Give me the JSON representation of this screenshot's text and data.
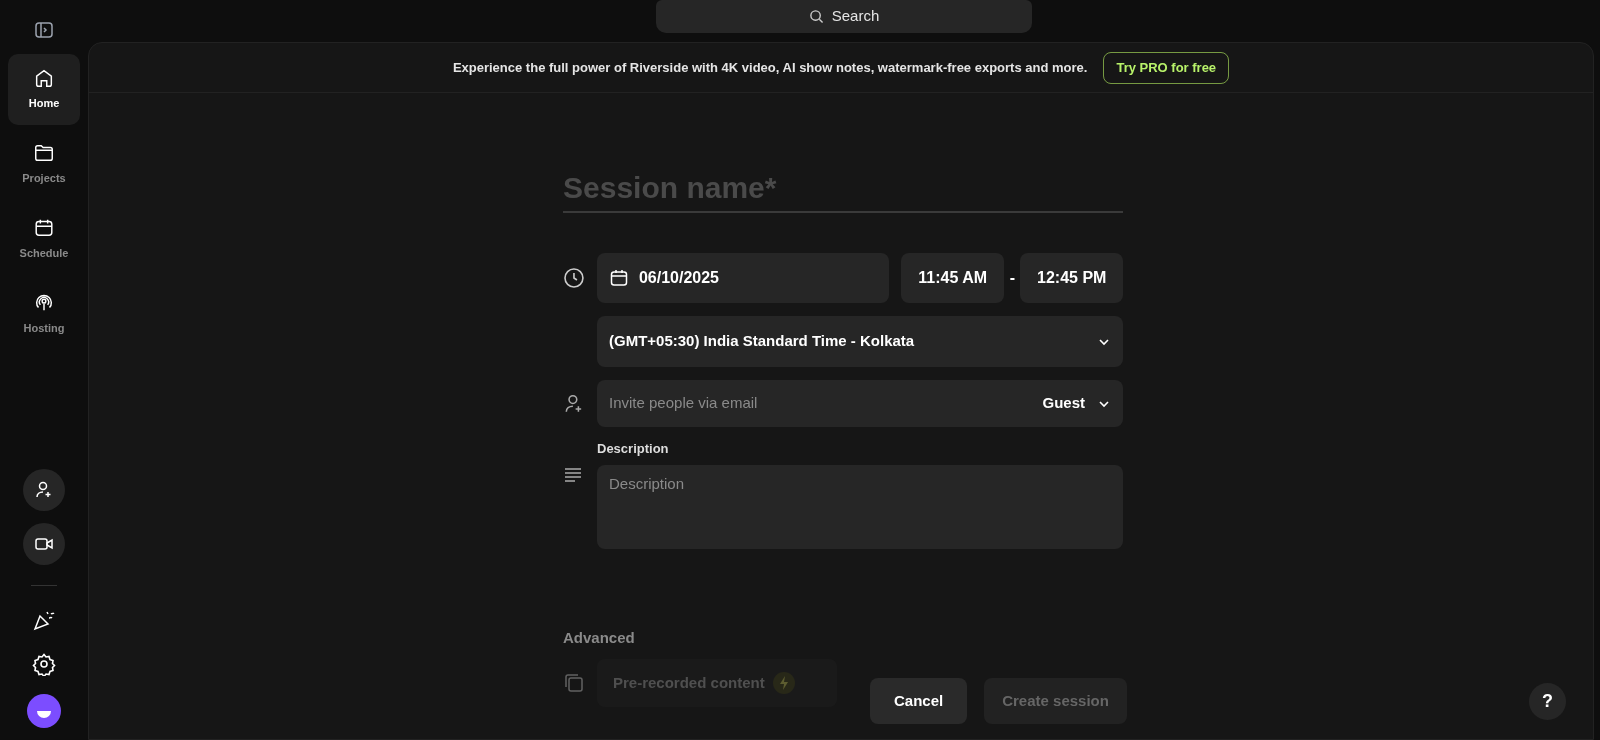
{
  "search": {
    "label": "Search"
  },
  "sidebar": {
    "items": [
      {
        "label": "Home",
        "selected": true
      },
      {
        "label": "Projects",
        "selected": false
      },
      {
        "label": "Schedule",
        "selected": false
      },
      {
        "label": "Hosting",
        "selected": false
      }
    ]
  },
  "banner": {
    "text": "Experience the full power of Riverside with 4K video, AI show notes, watermark-free exports and more.",
    "button": "Try PRO for free"
  },
  "form": {
    "session_name": {
      "placeholder": "Session name*"
    },
    "date": "06/10/2025",
    "start_time": "11:45 AM",
    "separator": "-",
    "end_time": "12:45 PM",
    "timezone": "(GMT+05:30) India Standard Time - Kolkata",
    "invite": {
      "placeholder": "Invite people via email",
      "role": "Guest"
    },
    "description": {
      "label": "Description",
      "placeholder": "Description"
    },
    "advanced": {
      "heading": "Advanced",
      "option": "Pre-recorded content"
    }
  },
  "buttons": [
    {
      "label": "Cancel",
      "disabled": false
    },
    {
      "label": "Create session",
      "disabled": true
    }
  ],
  "help": "?"
}
